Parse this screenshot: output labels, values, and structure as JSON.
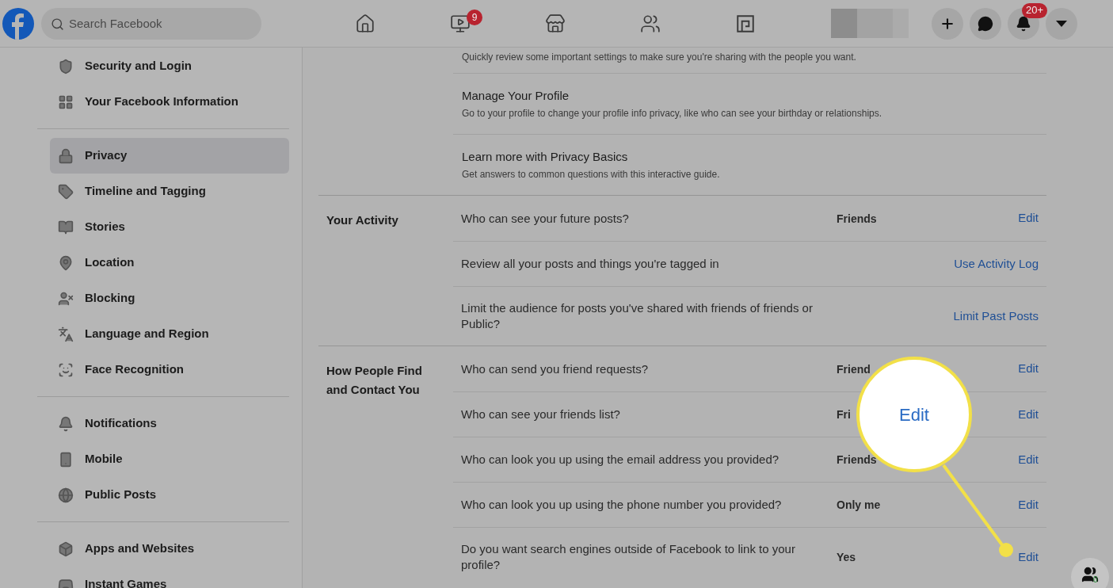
{
  "topbar": {
    "search": {
      "placeholder": "Search Facebook"
    },
    "nav": [
      {
        "kind": "home"
      },
      {
        "kind": "video",
        "badge": "9"
      },
      {
        "kind": "store"
      },
      {
        "kind": "groups"
      },
      {
        "kind": "gaming"
      }
    ],
    "actions": [
      {
        "kind": "plus"
      },
      {
        "kind": "messenger"
      },
      {
        "kind": "bell",
        "badge": "20+"
      },
      {
        "kind": "caret"
      }
    ]
  },
  "sidebar": {
    "groups": [
      [
        {
          "label": "Security and Login",
          "kind": "shield",
          "selected": false
        },
        {
          "label": "Your Facebook Information",
          "kind": "grid",
          "selected": false
        }
      ],
      [
        {
          "label": "Privacy",
          "kind": "lock",
          "selected": true
        },
        {
          "label": "Timeline and Tagging",
          "kind": "tag",
          "selected": false
        },
        {
          "label": "Stories",
          "kind": "book",
          "selected": false
        },
        {
          "label": "Location",
          "kind": "pin",
          "selected": false
        },
        {
          "label": "Blocking",
          "kind": "block",
          "selected": false
        },
        {
          "label": "Language and Region",
          "kind": "language",
          "selected": false
        },
        {
          "label": "Face Recognition",
          "kind": "face",
          "selected": false
        }
      ],
      [
        {
          "label": "Notifications",
          "kind": "bell",
          "selected": false
        },
        {
          "label": "Mobile",
          "kind": "phone",
          "selected": false
        },
        {
          "label": "Public Posts",
          "kind": "globe",
          "selected": false
        }
      ],
      [
        {
          "label": "Apps and Websites",
          "kind": "box",
          "selected": false
        },
        {
          "label": "Instant Games",
          "kind": "game",
          "selected": false
        }
      ]
    ]
  },
  "intro_rows": [
    {
      "description": "Quickly review some important settings to make sure you're sharing with the people you want."
    },
    {
      "title": "Manage Your Profile",
      "description": "Go to your profile to change your profile info privacy, like who can see your birthday or relationships."
    },
    {
      "title": "Learn more with Privacy Basics",
      "description": "Get answers to common questions with this interactive guide."
    }
  ],
  "sections": [
    {
      "title": "Your Activity",
      "rows": [
        {
          "question": "Who can see your future posts?",
          "value": "Friends",
          "action": "Edit"
        },
        {
          "question": "Review all your posts and things you're tagged in",
          "action": "Use Activity Log"
        },
        {
          "question": "Limit the audience for posts you've shared with friends of friends or Public?",
          "action": "Limit Past Posts"
        }
      ]
    },
    {
      "title": "How People Find and Contact You",
      "rows": [
        {
          "question": "Who can send you friend requests?",
          "value": "Friend",
          "action": "Edit"
        },
        {
          "question": "Who can see your friends list?",
          "value": "Fri",
          "action": "Edit"
        },
        {
          "question": "Who can look you up using the email address you provided?",
          "value": "Friends",
          "action": "Edit"
        },
        {
          "question": "Who can look you up using the phone number you provided?",
          "value": "Only me",
          "action": "Edit"
        },
        {
          "question": "Do you want search engines outside of Facebook to link to your profile?",
          "value": "Yes",
          "action": "Edit"
        }
      ]
    }
  ],
  "callout": {
    "label": "Edit"
  },
  "contacts_button": {
    "badge": "0"
  }
}
